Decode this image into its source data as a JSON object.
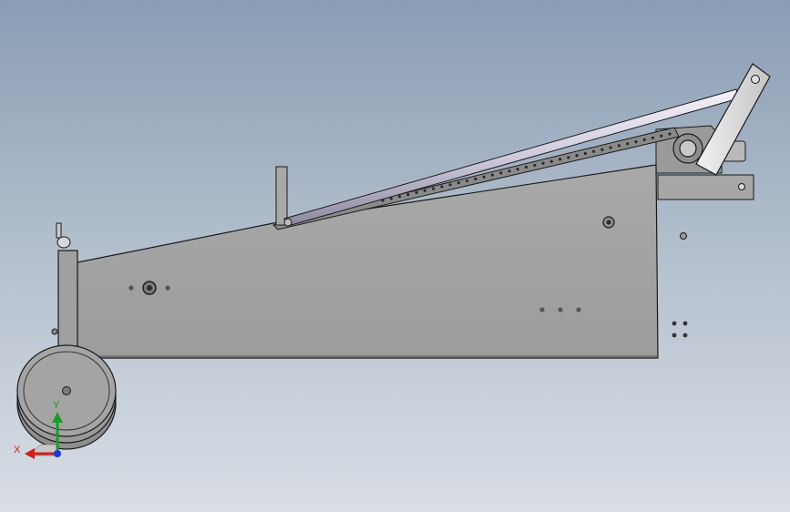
{
  "viewport": {
    "background_top": "#8a9db5",
    "background_bottom": "#d9dee6"
  },
  "model": {
    "body_color": "#a5a5a5",
    "rod_color": "#d8d4e2",
    "wheel_color": "#9e9e9e",
    "edge_color": "#1a1a1a"
  },
  "triad": {
    "x_label": "X",
    "y_label": "Y",
    "x_color": "#d0201a",
    "y_color": "#1a9c2a",
    "z_color": "#1a3ad0"
  }
}
